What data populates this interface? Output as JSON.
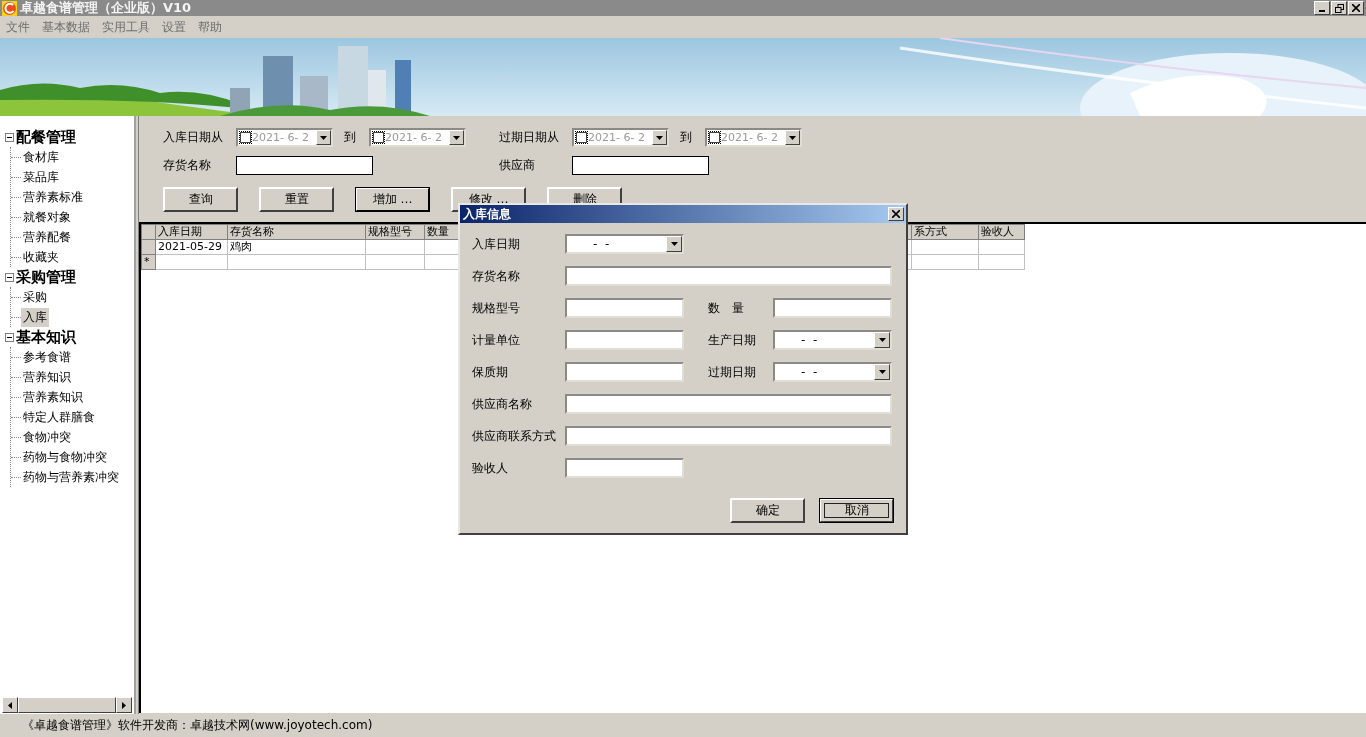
{
  "window": {
    "title": "卓越食谱管理（企业版）V10"
  },
  "menu": [
    "文件",
    "基本数据",
    "实用工具",
    "设置",
    "帮助"
  ],
  "tree": [
    {
      "label": "配餐管理",
      "expanded": true,
      "children": [
        {
          "label": "食材库",
          "selected": false
        },
        {
          "label": "菜品库",
          "selected": false
        },
        {
          "label": "营养素标准",
          "selected": false
        },
        {
          "label": "就餐对象",
          "selected": false
        },
        {
          "label": "营养配餐",
          "selected": false
        },
        {
          "label": "收藏夹",
          "selected": false
        }
      ]
    },
    {
      "label": "采购管理",
      "expanded": true,
      "children": [
        {
          "label": "采购",
          "selected": false
        },
        {
          "label": "入库",
          "selected": true
        }
      ]
    },
    {
      "label": "基本知识",
      "expanded": true,
      "children": [
        {
          "label": "参考食谱",
          "selected": false
        },
        {
          "label": "营养知识",
          "selected": false
        },
        {
          "label": "营养素知识",
          "selected": false
        },
        {
          "label": "特定人群膳食",
          "selected": false
        },
        {
          "label": "食物冲突",
          "selected": false
        },
        {
          "label": "药物与食物冲突",
          "selected": false
        },
        {
          "label": "药物与营养素冲突",
          "selected": false
        }
      ]
    }
  ],
  "filters": [
    {
      "kind": "date_range",
      "label": "入库日期从",
      "to_label": "到",
      "from": {
        "checked": false,
        "value": "2021- 6- 2"
      },
      "to": {
        "checked": false,
        "value": "2021- 6- 2"
      }
    },
    {
      "kind": "date_range",
      "label": "过期日期从",
      "to_label": "到",
      "from": {
        "checked": false,
        "value": "2021- 6- 2"
      },
      "to": {
        "checked": false,
        "value": "2021- 6- 2"
      }
    },
    {
      "kind": "text",
      "label": "存货名称"
    },
    {
      "kind": "text",
      "label": "供应商"
    }
  ],
  "buttons": [
    {
      "label": "查询",
      "default": false
    },
    {
      "label": "重置",
      "default": false
    },
    {
      "label": "增加 …",
      "default": true
    },
    {
      "label": "修改 …",
      "default": false
    },
    {
      "label": "删除",
      "default": false
    }
  ],
  "table": {
    "columns": [
      "入库日期",
      "存货名称",
      "规格型号",
      "数量",
      "系方式",
      "验收人"
    ],
    "rows": [
      {
        "cells": [
          "2021-05-29",
          "鸡肉"
        ]
      }
    ],
    "new_row_marker": "*"
  },
  "dialog": {
    "title": "入库信息",
    "rows": [
      [
        {
          "label": "入库日期",
          "kind": "date",
          "value": "-  -"
        }
      ],
      [
        {
          "label": "存货名称",
          "kind": "wide_text"
        }
      ],
      [
        {
          "label": "规格型号",
          "kind": "text"
        },
        {
          "label": "数　量",
          "kind": "text"
        }
      ],
      [
        {
          "label": "计量单位",
          "kind": "text"
        },
        {
          "label": "生产日期",
          "kind": "date",
          "value": "-  -"
        }
      ],
      [
        {
          "label": "保质期",
          "kind": "text"
        },
        {
          "label": "过期日期",
          "kind": "date",
          "value": "-  -"
        }
      ],
      [
        {
          "label": "供应商名称",
          "kind": "wide_text"
        }
      ],
      [
        {
          "label": "供应商联系方式",
          "kind": "wide_text"
        }
      ],
      [
        {
          "label": "验收人",
          "kind": "text"
        }
      ]
    ],
    "buttons": [
      {
        "label": "确定",
        "focused": false
      },
      {
        "label": "取消",
        "focused": true
      }
    ]
  },
  "status_bar": "《卓越食谱管理》软件开发商：卓越技术网(www.joyotech.com)"
}
